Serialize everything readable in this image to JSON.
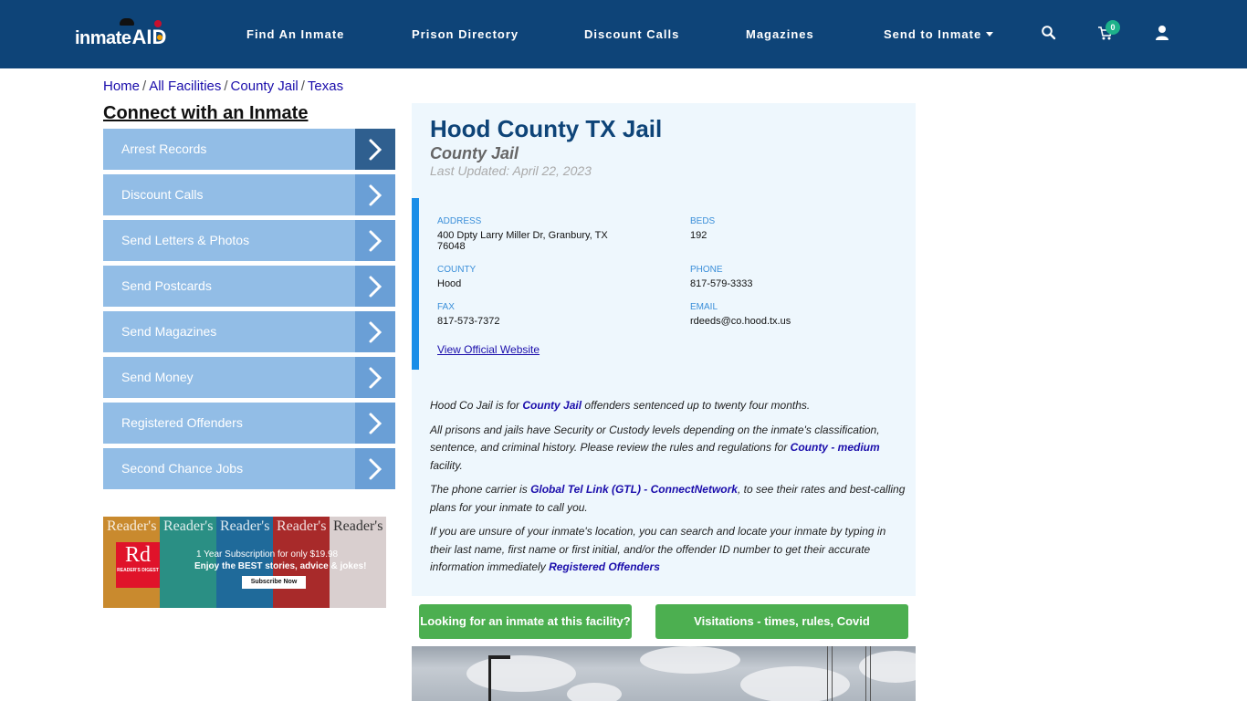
{
  "navbar": {
    "logo_text": "inmate",
    "logo_accent": "AID",
    "items": [
      {
        "label": "Find An Inmate"
      },
      {
        "label": "Prison Directory"
      },
      {
        "label": "Discount Calls"
      },
      {
        "label": "Magazines"
      },
      {
        "label": "Send to Inmate",
        "dropdown": true
      }
    ],
    "icons": [
      "search-icon",
      "cart-icon",
      "user-icon"
    ],
    "cart_count": "0"
  },
  "breadcrumb": [
    "Home",
    "All Facilities",
    "County Jail",
    "Texas"
  ],
  "sidebar": {
    "title": "Connect with an Inmate",
    "items": [
      {
        "label": "Arrest Records"
      },
      {
        "label": "Discount Calls"
      },
      {
        "label": "Send Letters & Photos"
      },
      {
        "label": "Send Postcards"
      },
      {
        "label": "Send Magazines"
      },
      {
        "label": "Send Money"
      },
      {
        "label": "Registered Offenders"
      },
      {
        "label": "Second Chance Jobs"
      }
    ]
  },
  "ad": {
    "brand_short": "Rd",
    "brand_name": "READER'S DIGEST",
    "mast": "Reader's",
    "line1": "1 Year Subscription for only $19.98",
    "line2": "Enjoy the BEST stories, advice & jokes!",
    "button": "Subscribe Now"
  },
  "facility": {
    "name": "Hood County TX Jail",
    "type": "County Jail",
    "last_updated": "Last Updated: April 22, 2023",
    "fields": {
      "address": {
        "label": "Address",
        "value": "400 Dpty Larry Miller Dr, Granbury, TX 76048"
      },
      "beds": {
        "label": "Beds",
        "value": "192"
      },
      "county": {
        "label": "County",
        "value": "Hood"
      },
      "phone": {
        "label": "Phone",
        "value": "817-579-3333"
      },
      "fax": {
        "label": "Fax",
        "value": "817-573-7372"
      },
      "email": {
        "label": "Email",
        "value": "rdeeds@co.hood.tx.us"
      }
    },
    "website_link": "View Official Website"
  },
  "description": {
    "p1": {
      "a": "Hood Co Jail is for ",
      "link": "County Jail",
      "b": " offenders sentenced up to twenty four months."
    },
    "p2": {
      "a": "All prisons and jails have Security or Custody levels depending on the inmate's classification, sentence, and criminal history. Please review the rules and regulations for ",
      "link": "County - medium",
      "b": " facility."
    },
    "p3": {
      "a": "The phone carrier is ",
      "link": "Global Tel Link (GTL) - ConnectNetwork",
      "b": ", to see their rates and best-calling plans for your inmate to call you."
    },
    "p4": {
      "a": "If you are unsure of your inmate's location, you can search and locate your inmate by typing in their last name, first name or first initial, and/or the offender ID number to get their accurate information immediately ",
      "link": "Registered Offenders",
      "b": ""
    }
  },
  "buttons": {
    "find_inmate": "Looking for an inmate at this facility?",
    "visitation": "Visitations - times, rules, Covid cancellations"
  },
  "colors": {
    "navbar": "#0e4478",
    "sidebar_item": "#92bde6",
    "accent_blue": "#1a8ee8",
    "button_green": "#4caf50",
    "link": "#1a0dab"
  }
}
